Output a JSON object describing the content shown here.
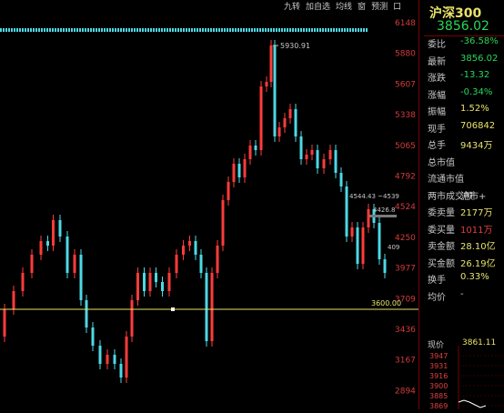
{
  "toolbar": {
    "items": [
      "九转",
      "加自选",
      "均线",
      "窗",
      "预测"
    ],
    "close_label": "口"
  },
  "index": {
    "name": "沪深300",
    "last": "3856.02"
  },
  "y_axis": {
    "labels": [
      "6148",
      "5880",
      "5607",
      "5338",
      "5065",
      "4792",
      "4524",
      "4250",
      "3977",
      "3709",
      "3436",
      "3167",
      "2894"
    ]
  },
  "annotations": {
    "peak": "5930.91",
    "ma_a": "4544.43",
    "ma_b": "4539",
    "mid": "4426.8",
    "mid_b": "409",
    "support": "3600.00"
  },
  "stats": [
    {
      "k": "委比",
      "v": "-36.58%",
      "c": "#27d85a"
    },
    {
      "k": "最新",
      "v": "3856.02",
      "c": "#27d85a"
    },
    {
      "k": "涨跌",
      "v": "-13.32",
      "c": "#27d85a"
    },
    {
      "k": "涨幅",
      "v": "-0.34%",
      "c": "#27d85a"
    },
    {
      "k": "振幅",
      "v": "1.52%",
      "c": "#e8e26a"
    },
    {
      "k": "现手",
      "v": "706842",
      "c": "#e8e26a"
    },
    {
      "k": "总手",
      "v": "9434万",
      "c": "#e8e26a"
    },
    {
      "k": "总市值",
      "v": "",
      "c": "#c8c8c8"
    },
    {
      "k": "流通市值",
      "v": "",
      "c": "#c8c8c8"
    },
    {
      "k": "两市成交额",
      "v": "沪市+",
      "c": "#c8c8c8"
    },
    {
      "k": "委卖量",
      "v": "2177万",
      "c": "#e8e26a"
    },
    {
      "k": "委买量",
      "v": "1011万",
      "c": "#e04040"
    },
    {
      "k": "卖金额",
      "v": "28.10亿",
      "c": "#e8e26a"
    },
    {
      "k": "买金额",
      "v": "26.19亿",
      "c": "#e8e26a"
    },
    {
      "k": "换手",
      "v": "0.33%",
      "c": "#e8e26a"
    },
    {
      "k": "均价",
      "v": "-",
      "c": "#c8c8c8"
    }
  ],
  "mini": {
    "label": "现价",
    "value": "3861.11",
    "ticks": [
      "3947",
      "3931",
      "3916",
      "3900",
      "3885",
      "3869"
    ]
  },
  "colors": {
    "up": "#ff3b3b",
    "down": "#4dd8e6",
    "axis": "#d23b3b",
    "accent": "#e8e26a"
  }
}
